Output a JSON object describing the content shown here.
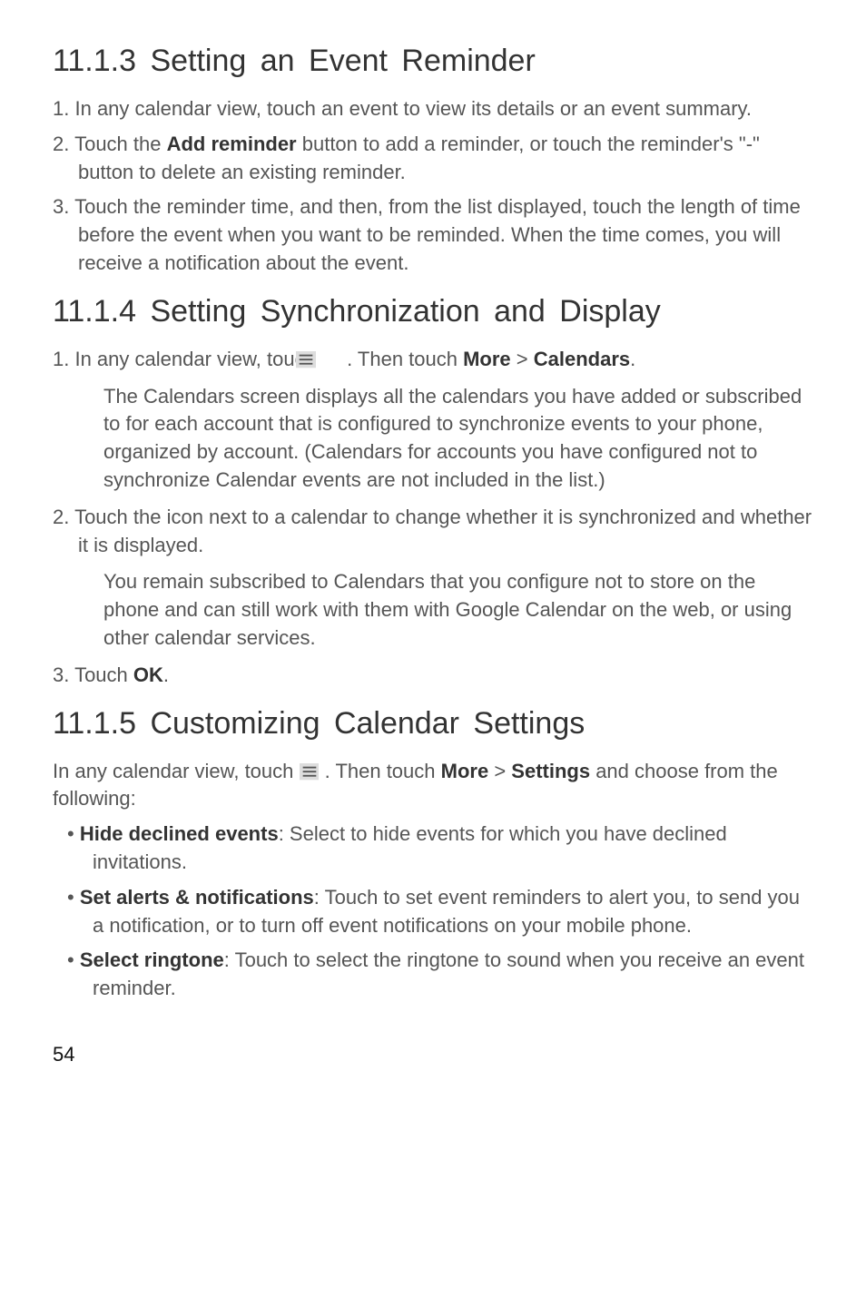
{
  "s1113": {
    "title": "11.1.3  Setting an Event Reminder",
    "items": [
      {
        "n": "1.",
        "text": "In any calendar view, touch an event to view its details or an event summary."
      },
      {
        "n": "2.",
        "pre": "Touch the ",
        "bold": "Add reminder",
        "post": " button to add a reminder, or touch the reminder's \"-\" button to delete an existing reminder."
      },
      {
        "n": "3.",
        "text": "Touch the reminder time, and then, from the list displayed, touch the length of time before the event when you want to be reminded. When the time comes, you will receive a notification about the event."
      }
    ]
  },
  "s1114": {
    "title": "11.1.4  Setting Synchronization and Display",
    "step1_pre": "1. In any calendar view, touch ",
    "step1_mid": " . Then touch ",
    "step1_b1": "More",
    "step1_gt": " > ",
    "step1_b2": "Calendars",
    "step1_end": ".",
    "step1_ind": "The Calendars screen displays all the calendars you have added or subscribed to for each account that is configured to synchronize events to your phone, organized by account. (Calendars for accounts you have configured not to synchronize Calendar events are not included in the list.)",
    "step2": "2. Touch the icon next to a calendar to change whether it is synchronized and whether it is displayed.",
    "step2_ind": "You remain subscribed to Calendars that you configure not to store on the phone and can still work with them with Google Calendar on the web, or using other calendar services.",
    "step3_pre": "3. Touch ",
    "step3_b": "OK",
    "step3_end": "."
  },
  "s1115": {
    "title": "11.1.5  Customizing Calendar Settings",
    "intro_pre": "In any calendar view, touch ",
    "intro_mid": " . Then touch ",
    "intro_b1": "More",
    "intro_gt": " > ",
    "intro_b2": "Settings",
    "intro_end": " and choose from the following:",
    "bullets": [
      {
        "b": "Hide declined events",
        "t": ": Select to hide events for which you have declined invitations."
      },
      {
        "b": "Set alerts & notifications",
        "t": ": Touch to set event reminders to alert you, to send you a notification, or to turn off event notifications on your mobile phone."
      },
      {
        "b": "Select ringtone",
        "t": ": Touch to select the ringtone to sound when you receive an event reminder."
      }
    ]
  },
  "page": "54"
}
